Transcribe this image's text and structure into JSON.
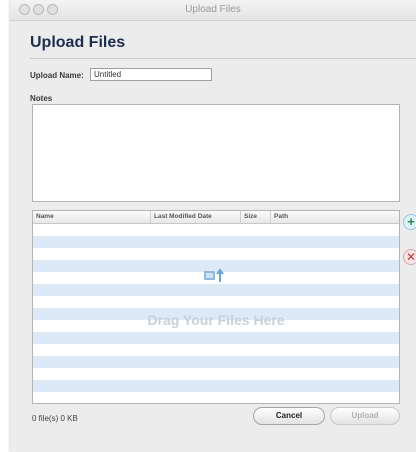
{
  "window": {
    "title": "Upload Files"
  },
  "header": {
    "title": "Upload Files"
  },
  "form": {
    "upload_name_label": "Upload Name:",
    "upload_name_value": "Untitled",
    "notes_label": "Notes",
    "notes_value": ""
  },
  "file_table": {
    "columns": [
      "Name",
      "Last Modified Date",
      "Size",
      "Path"
    ],
    "rows": [],
    "drop_hint": "Drag Your Files Here"
  },
  "footer": {
    "status": "0 file(s) 0 KB",
    "cancel_label": "Cancel",
    "upload_label": "Upload"
  },
  "colors": {
    "title_color": "#1e2e4f",
    "row_stripe": "#dde9f6",
    "add_icon": "#2b8a3c",
    "remove_icon": "#c23b3b"
  }
}
